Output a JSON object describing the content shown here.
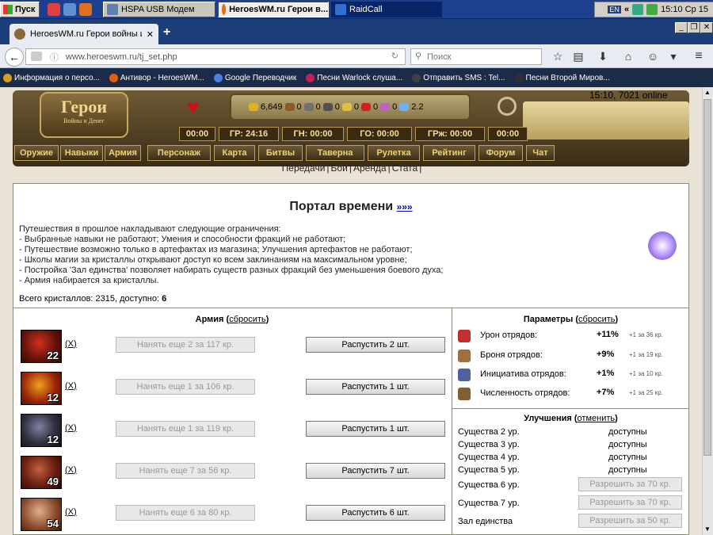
{
  "taskbar": {
    "start_label": "Пуск",
    "tasks": [
      {
        "label": "HSPA USB Модем"
      },
      {
        "label": "HeroesWM.ru Герои в..."
      },
      {
        "label": "RaidCall"
      }
    ],
    "tray_lang": "EN",
    "tray_time": "15:10 Ср 15"
  },
  "browser": {
    "tab_title": "HeroesWM.ru Герои войны и...",
    "url": "www.heroeswm.ru/tj_set.php",
    "search_placeholder": "Поиск",
    "bookmarks": [
      {
        "label": "Информация о персо...",
        "color": "#d4a020"
      },
      {
        "label": "Антивор - HeroesWM...",
        "color": "#e06010"
      },
      {
        "label": "Google Переводчик",
        "color": "#4a80e0"
      },
      {
        "label": "Песни Warlock слуша...",
        "color": "#c02060"
      },
      {
        "label": "Отправить SMS : Tel...",
        "color": "#404040"
      },
      {
        "label": "Песни Второй Миров...",
        "color": "#303030"
      }
    ]
  },
  "game_header": {
    "logo_title": "Герои",
    "logo_subtitle": "Войны и Денег",
    "online": "15:10, 7021 online",
    "resources": [
      {
        "value": "6,649",
        "color": "#e0b020"
      },
      {
        "value": "0",
        "color": "#8a5a2a"
      },
      {
        "value": "0",
        "color": "#707070"
      },
      {
        "value": "0",
        "color": "#505050"
      },
      {
        "value": "0",
        "color": "#e0c040"
      },
      {
        "value": "0",
        "color": "#d02020"
      },
      {
        "value": "0",
        "color": "#c060c0"
      },
      {
        "value": "2.2",
        "color": "#70b0f0"
      }
    ],
    "timers": [
      "00:00",
      "ГР: 24:16",
      "ГН: 00:00",
      "ГО: 00:00",
      "ГРж: 00:00",
      "00:00"
    ],
    "menu": [
      "Оружие",
      "Навыки",
      "Армия",
      "Персонаж",
      "Карта",
      "Битвы",
      "Таверна",
      "Рулетка",
      "Рейтинг",
      "Форум",
      "Чат"
    ],
    "submenu": [
      "Передачи",
      "Бои",
      "Аренда",
      "Стата"
    ]
  },
  "portal": {
    "title": "Портал времени",
    "title_link": "»»»",
    "rules": [
      "Путешествия в прошлое накладывают следующие ограничения:",
      "- Выбранные навыки не работают; Умения и способности фракций не работают;",
      "- Путешествие возможно только в артефактах из магазина; Улучшения артефактов не работают;",
      "- Школы магии за кристаллы открывают доступ ко всем заклинаниям на максимальном уровне;",
      "- Постройка 'Зал единства' позволяет набирать существ разных фракций без уменьшения боевого духа;",
      "- Армия набирается за кристаллы."
    ],
    "crystals_label": "Всего кристаллов: 2315, доступно:",
    "crystals_available": "6"
  },
  "army": {
    "title": "Армия",
    "reset_label": "сбросить",
    "units": [
      {
        "count": "22",
        "x_label": "X",
        "hire": "Нанять еще 2 за 117 кр.",
        "dismiss": "Распустить 2 шт.",
        "color": "#b02818"
      },
      {
        "count": "12",
        "x_label": "X",
        "hire": "Нанять еще 1 за 106 кр.",
        "dismiss": "Распустить 1 шт.",
        "color": "#c04010"
      },
      {
        "count": "12",
        "x_label": "X",
        "hire": "Нанять еще 1 за 119 кр.",
        "dismiss": "Распустить 1 шт.",
        "color": "#404048"
      },
      {
        "count": "49",
        "x_label": "X",
        "hire": "Нанять еще 7 за 56 кр.",
        "dismiss": "Распустить 7 шт.",
        "color": "#903020"
      },
      {
        "count": "54",
        "x_label": "X",
        "hire": "Нанять еще 6 за 80 кр.",
        "dismiss": "Распустить 6 шт.",
        "color": "#a07050"
      }
    ]
  },
  "params": {
    "title": "Параметры",
    "reset_label": "сбросить",
    "rows": [
      {
        "name": "Урон отрядов:",
        "value": "+11%",
        "note": "+1 за 36 кр.",
        "color": "#c03030"
      },
      {
        "name": "Броня отрядов:",
        "value": "+9%",
        "note": "+1 за 19 кр.",
        "color": "#a07040"
      },
      {
        "name": "Инициатива отрядов:",
        "value": "+1%",
        "note": "+1 за 10 кр.",
        "color": "#5060a0"
      },
      {
        "name": "Численность отрядов:",
        "value": "+7%",
        "note": "+1 за 25 кр.",
        "color": "#806030"
      }
    ]
  },
  "upgrades": {
    "title": "Улучшения",
    "cancel_label": "отменить",
    "rows": [
      {
        "name": "Существа 2 ур.",
        "status": "доступны"
      },
      {
        "name": "Существа 3 ур.",
        "status": "доступны"
      },
      {
        "name": "Существа 4 ур.",
        "status": "доступны"
      },
      {
        "name": "Существа 5 ур.",
        "status": "доступны"
      },
      {
        "name": "Существа 6 ур.",
        "button": "Разрешить за 70 кр."
      },
      {
        "name": "Существа 7 ур.",
        "button": "Разрешить за 70 кр."
      },
      {
        "name": "Зал единства",
        "button": "Разрешить за 50 кр."
      }
    ]
  }
}
